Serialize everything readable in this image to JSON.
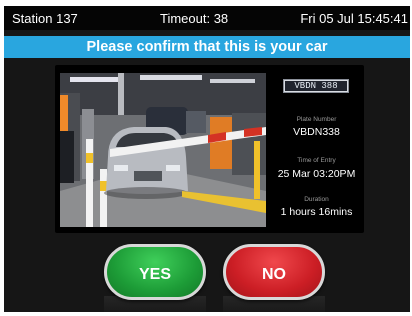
{
  "header": {
    "station": "Station 137",
    "timeout": "Timeout: 38",
    "datetime": "Fri 05 Jul 15:45:41"
  },
  "banner": {
    "text": "Please confirm that this is your car"
  },
  "details": {
    "plate_image_text": "VBDN 388",
    "plate_label": "Plate Number",
    "plate_value": "VBDN338",
    "entry_label": "Time of Entry",
    "entry_value": "25 Mar 03:20PM",
    "duration_label": "Duration",
    "duration_value": "1 hours 16mins"
  },
  "buttons": {
    "yes_label": "YES",
    "no_label": "NO"
  },
  "colors": {
    "banner": "#29a6df",
    "yes_button": "#1d9c37",
    "no_button": "#cc1e25",
    "background": "#161616"
  }
}
